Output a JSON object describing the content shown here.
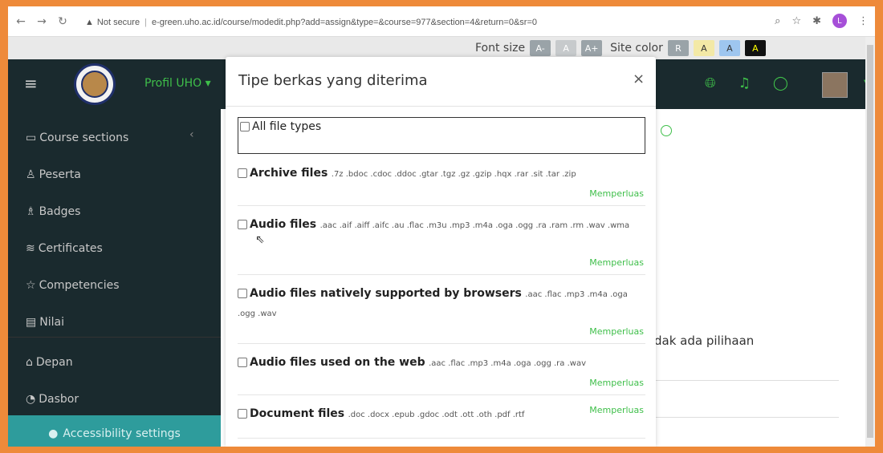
{
  "browser": {
    "security_label": "Not secure",
    "url": "e-green.uho.ac.id/course/modedit.php?add=assign&type=&course=977&section=4&return=0&sr=0",
    "profile_initial": "L"
  },
  "a11y_bar": {
    "font_size_label": "Font size",
    "font_buttons": [
      "A-",
      "A",
      "A+"
    ],
    "site_color_label": "Site color",
    "color_buttons": [
      "R",
      "A",
      "A",
      "A"
    ]
  },
  "navbar": {
    "profil_label": "Profil UHO"
  },
  "sidebar": {
    "items": [
      {
        "label": "Course sections",
        "icon": "folder-icon"
      },
      {
        "label": "Peserta",
        "icon": "users-icon"
      },
      {
        "label": "Badges",
        "icon": "badge-icon"
      },
      {
        "label": "Certificates",
        "icon": "certificate-icon"
      },
      {
        "label": "Competencies",
        "icon": "star-icon"
      },
      {
        "label": "Nilai",
        "icon": "gradebook-icon"
      },
      {
        "label": "Depan",
        "icon": "home-icon"
      },
      {
        "label": "Dasbor",
        "icon": "dashboard-icon"
      }
    ],
    "accessibility_label": "Accessibility settings"
  },
  "main": {
    "partial_text": "dak ada pilihaan"
  },
  "modal": {
    "title": "Tipe berkas yang diterima",
    "close_glyph": "×",
    "all_types_label": "All file types",
    "file_types": [
      {
        "name": "Archive files",
        "extensions": ".7z .bdoc .cdoc .ddoc .gtar .tgz .gz .gzip .hqx .rar .sit .tar .zip",
        "more": "Memperluas"
      },
      {
        "name": "Audio files",
        "extensions": ".aac .aif .aiff .aifc .au .flac .m3u .mp3 .m4a .oga .ogg .ra .ram .rm .wav .wma",
        "more": "Memperluas"
      },
      {
        "name": "Audio files natively supported by browsers",
        "extensions": ".aac .flac .mp3 .m4a .oga .ogg .wav",
        "more": "Memperluas"
      },
      {
        "name": "Audio files used on the web",
        "extensions": ".aac .flac .mp3 .m4a .oga .ogg .ra .wav",
        "more": "Memperluas"
      },
      {
        "name": "Document files",
        "extensions": ".doc .docx .epub .gdoc .odt .ott .oth .pdf .rtf",
        "more": "Memperluas"
      }
    ]
  }
}
